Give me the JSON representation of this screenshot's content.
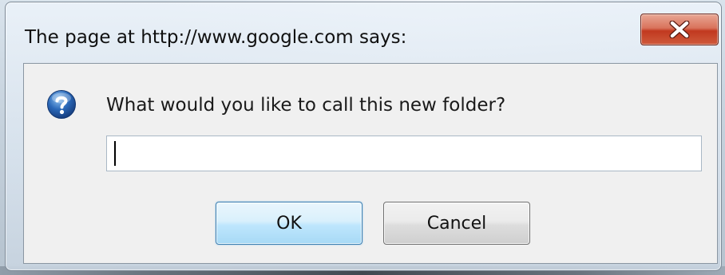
{
  "dialog": {
    "title": "The page at http://www.google.com says:",
    "close_icon": "close-x-icon",
    "message_icon": "question-icon",
    "message": "What would you like to call this new folder?",
    "input": {
      "value": "",
      "placeholder": ""
    },
    "buttons": {
      "ok_label": "OK",
      "cancel_label": "Cancel"
    },
    "colors": {
      "close_button": "#c1391f",
      "ok_border": "#3c7fb1",
      "question_icon": "#2a68b8"
    }
  }
}
